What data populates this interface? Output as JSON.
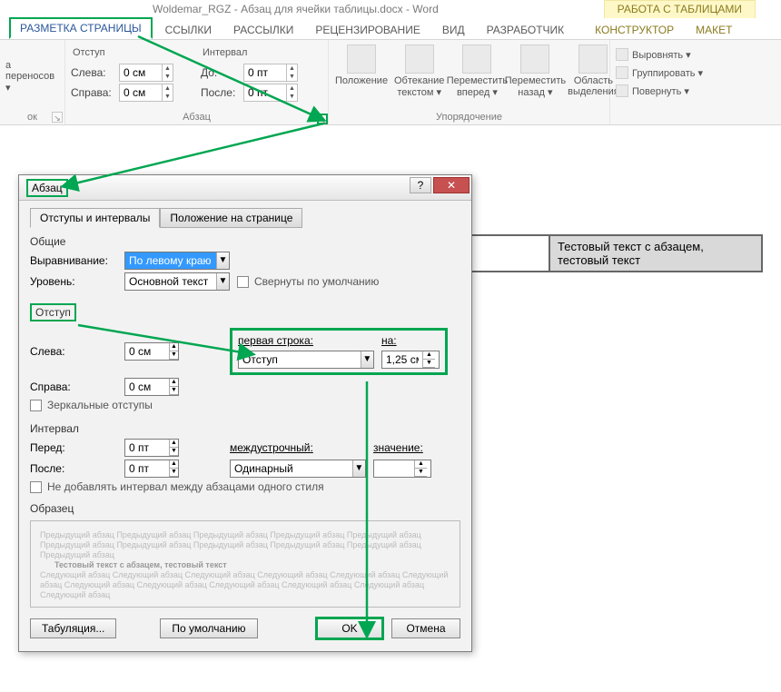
{
  "title": "Woldemar_RGZ - Абзац для ячейки таблицы.docx - Word",
  "context_tab_title": "РАБОТА С ТАБЛИЦАМИ",
  "tabs": {
    "layout": "РАЗМЕТКА СТРАНИЦЫ",
    "refs": "ССЫЛКИ",
    "mailings": "РАССЫЛКИ",
    "review": "РЕЦЕНЗИРОВАНИЕ",
    "view": "ВИД",
    "developer": "РАЗРАБОТЧИК",
    "design": "КОНСТРУКТОР",
    "tlayout": "МАКЕТ"
  },
  "ribbon": {
    "hyphen": "а переносов ▾",
    "hyphen_group": "ок",
    "indent_hdr": "Отступ",
    "spacing_hdr": "Интервал",
    "left_lbl": "Слева:",
    "right_lbl": "Справа:",
    "before_lbl": "До:",
    "after_lbl": "После:",
    "left_v": "0 см",
    "right_v": "0 см",
    "before_v": "0 пт",
    "after_v": "0 пт",
    "paragraph_group": "Абзац",
    "position": "Положение",
    "wrap": "Обтекание текстом ▾",
    "forward": "Переместить вперед ▾",
    "backward": "Переместить назад ▾",
    "selpane": "Область выделения",
    "align": "Выровнять ▾",
    "group": "Группировать ▾",
    "rotate": "Повернуть ▾",
    "arrange_group": "Упорядочение"
  },
  "table_cell_b": "Тестовый текст с абзацем, тестовый текст",
  "dlg": {
    "title": "Абзац",
    "tab1": "Отступы и интервалы",
    "tab2": "Положение на странице",
    "sec_general": "Общие",
    "align_lbl": "Выравнивание:",
    "align_val": "По левому краю",
    "level_lbl": "Уровень:",
    "level_val": "Основной текст",
    "collapsed": "Свернуты по умолчанию",
    "sec_indent": "Отступ",
    "left": "Слева:",
    "left_v": "0 см",
    "right": "Справа:",
    "right_v": "0 см",
    "first_line_lbl": "первая строка:",
    "first_line_val": "Отступ",
    "by_lbl": "на:",
    "by_val": "1,25 см",
    "mirror": "Зеркальные отступы",
    "sec_spacing": "Интервал",
    "before": "Перед:",
    "before_v": "0 пт",
    "after": "После:",
    "after_v": "0 пт",
    "linesp_lbl": "междустрочный:",
    "linesp_val": "Одинарный",
    "value_lbl": "значение:",
    "noadd": "Не добавлять интервал между абзацами одного стиля",
    "sec_preview": "Образец",
    "preview_prev": "Предыдущий абзац Предыдущий абзац Предыдущий абзац Предыдущий абзац Предыдущий абзац Предыдущий абзац Предыдущий абзац Предыдущий абзац Предыдущий абзац Предыдущий абзац Предыдущий абзац",
    "preview_sample": "Тестовый текст с абзацем, тестовый текст",
    "preview_next": "Следующий абзац Следующий абзац Следующий абзац Следующий абзац Следующий абзац Следующий абзац Следующий абзац Следующий абзац Следующий абзац Следующий абзац Следующий абзац Следующий абзац",
    "btn_tabs": "Табуляция...",
    "btn_default": "По умолчанию",
    "btn_ok": "OK",
    "btn_cancel": "Отмена"
  }
}
